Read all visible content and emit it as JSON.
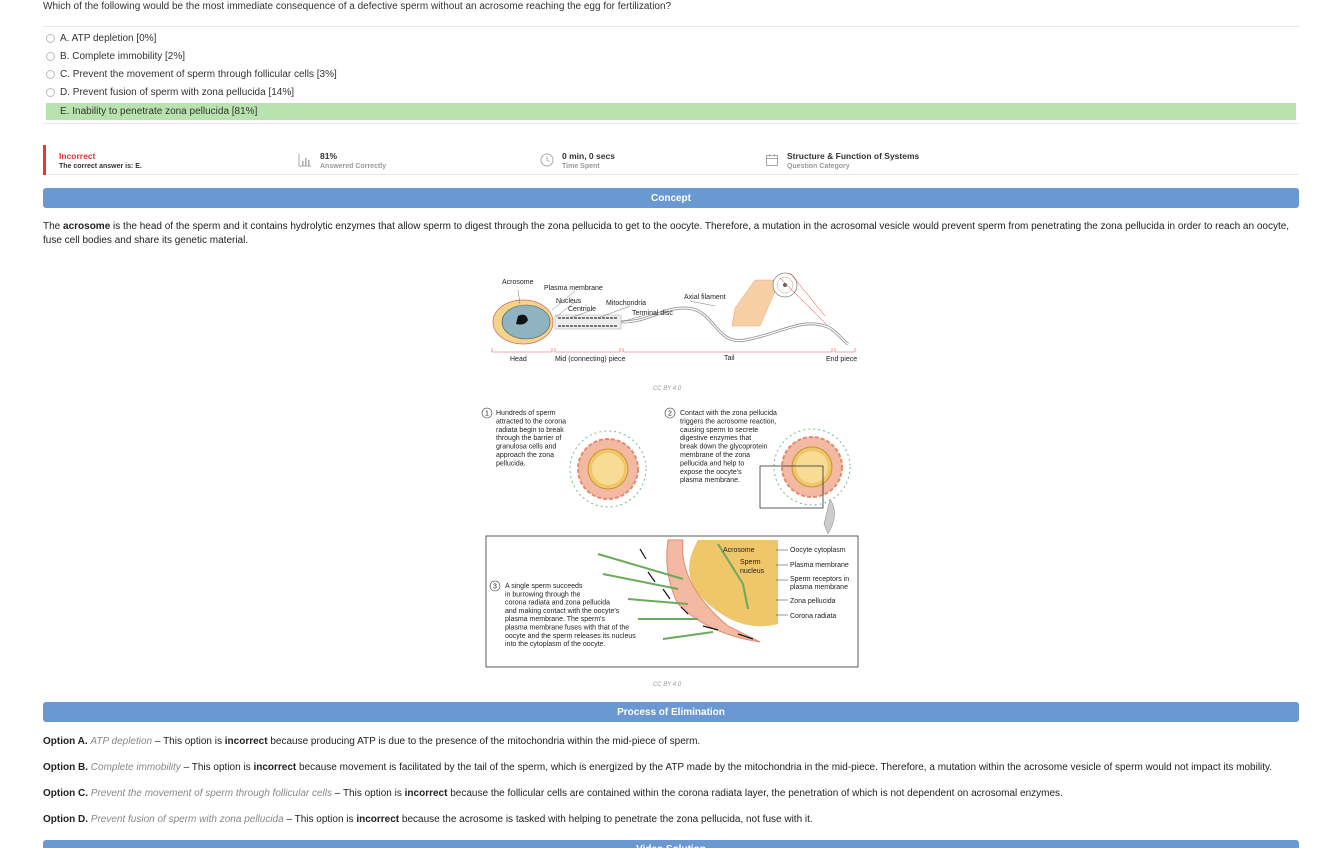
{
  "question": "Which of the following would be the most immediate consequence of a defective sperm without an acrosome reaching the egg for fertilization?",
  "choices": [
    {
      "label": "A. ATP depletion [0%]",
      "correct": false
    },
    {
      "label": "B. Complete immobility [2%]",
      "correct": false
    },
    {
      "label": "C. Prevent the movement of sperm through follicular cells [3%]",
      "correct": false
    },
    {
      "label": "D. Prevent fusion of sperm with zona pellucida [14%]",
      "correct": false
    },
    {
      "label": "E. Inability to penetrate zona pellucida [81%]",
      "correct": true
    }
  ],
  "stats": {
    "result": "Incorrect",
    "result_sub": "The correct answer is: E.",
    "percent": "81%",
    "percent_sub": "Answered Correctly",
    "time": "0 min, 0 secs",
    "time_sub": "Time Spent",
    "category": "Structure & Function of Systems",
    "category_sub": "Question Category"
  },
  "concept": {
    "title": "Concept",
    "text_pre": "The ",
    "text_bold": "acrosome",
    "text_post": " is the head of the sperm and it contains hydrolytic enzymes that allow sperm to digest through the zona pellucida to get to the oocyte. Therefore, a mutation in the acrosomal vesicle would prevent sperm from penetrating the zona pellucida in order to reach an oocyte, fuse cell bodies and share its genetic material."
  },
  "figure1": {
    "labels": {
      "acrosome": "Acrosome",
      "plasma_membrane": "Plasma membrane",
      "nucleus": "Nucleus",
      "centriole": "Centriole",
      "mitochondria": "Mitochondria",
      "terminal_disc": "Terminal disc",
      "axial_filament": "Axial filament",
      "head": "Head",
      "mid_piece": "Mid (connecting) piece",
      "tail": "Tail",
      "end_piece": "End piece"
    },
    "caption": "CC BY 4.0"
  },
  "figure2": {
    "step1_num": "1",
    "step1": [
      "Hundreds of sperm",
      "attracted to the corona",
      "radiata begin to break",
      "through the barrier of",
      "granulosa cells and",
      "approach the zona",
      "pellucida."
    ],
    "step2_num": "2",
    "step2": [
      "Contact with the zona pellucida",
      "triggers the acrosome reaction,",
      "causing sperm to secrete",
      "digestive enzymes that",
      "break down the glycoprotein",
      "membrane of the zona",
      "pellucida and help to",
      "expose the oocyte's",
      "plasma membrane."
    ],
    "step3_num": "3",
    "step3": [
      "A single sperm succeeds",
      "in burrowing through the",
      "corona radiata and zona pellucida",
      "and making contact with the oocyte's",
      "plasma membrane. The sperm's",
      "plasma membrane fuses with that of the",
      "oocyte and the sperm releases its nucleus",
      "into the cytoplasm of the oocyte."
    ],
    "labels": {
      "acrosome": "Acrosome",
      "sperm_nucleus_1": "Sperm",
      "sperm_nucleus_2": "nucleus",
      "oocyte_cytoplasm": "Oocyte cytoplasm",
      "plasma_membrane": "Plasma membrane",
      "receptors_1": "Sperm receptors in",
      "receptors_2": "plasma membrane",
      "zona_pellucida": "Zona pellucida",
      "corona_radiata": "Corona radiata"
    },
    "caption": "CC BY 4.0"
  },
  "elimination": {
    "title": "Process of Elimination",
    "options": [
      {
        "label": "Option A.",
        "title": "ATP depletion",
        "pre": " – This option is ",
        "neg": "incorrect",
        "post": " because producing ATP is due to the presence of the mitochondria within the mid-piece of sperm."
      },
      {
        "label": "Option B.",
        "title": "Complete immobility",
        "pre": " – This option is ",
        "neg": "incorrect",
        "post": " because movement is facilitated by the tail of the sperm, which is energized by the ATP made by the mitochondria in the mid-piece. Therefore, a mutation within the acrosome vesicle of sperm would not impact its mobility."
      },
      {
        "label": "Option C.",
        "title": "Prevent the movement of sperm through follicular cells",
        "pre": " – This option is ",
        "neg": "incorrect",
        "post": " because the follicular cells are contained within the corona radiata layer, the penetration of which is not dependent on acrosomal enzymes."
      },
      {
        "label": "Option D.",
        "title": "Prevent fusion of sperm with zona pellucida",
        "pre": " – This option is ",
        "neg": "incorrect",
        "post": " because the acrosome is tasked with helping to penetrate the zona pellucida, not fuse with it."
      }
    ]
  },
  "video": {
    "title": "Video Solution"
  },
  "colors": {
    "banner": "#6a98d2",
    "correct": "#b9e3ae",
    "incorrect": "#e33333"
  }
}
